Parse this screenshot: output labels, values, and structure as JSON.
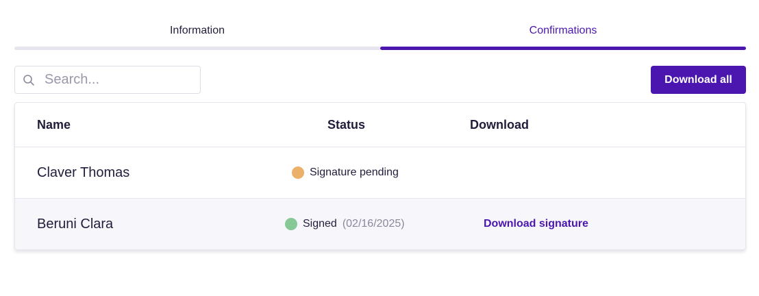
{
  "tabs": [
    {
      "label": "Information",
      "active": false
    },
    {
      "label": "Confirmations",
      "active": true
    }
  ],
  "search": {
    "placeholder": "Search...",
    "value": "",
    "icon": "search-icon"
  },
  "toolbar": {
    "download_all_label": "Download all"
  },
  "table": {
    "columns": {
      "name": "Name",
      "status": "Status",
      "download": "Download"
    },
    "rows": [
      {
        "name": "Claver Thomas",
        "status": "Signature pending",
        "status_color": "#ebb06a",
        "date": "",
        "download_label": ""
      },
      {
        "name": "Beruni Clara",
        "status": "Signed",
        "status_color": "#86c996",
        "date": "(02/16/2025)",
        "download_label": "Download signature"
      }
    ]
  },
  "colors": {
    "accent": "#4b16b0",
    "pending": "#ebb06a",
    "signed": "#86c996"
  }
}
